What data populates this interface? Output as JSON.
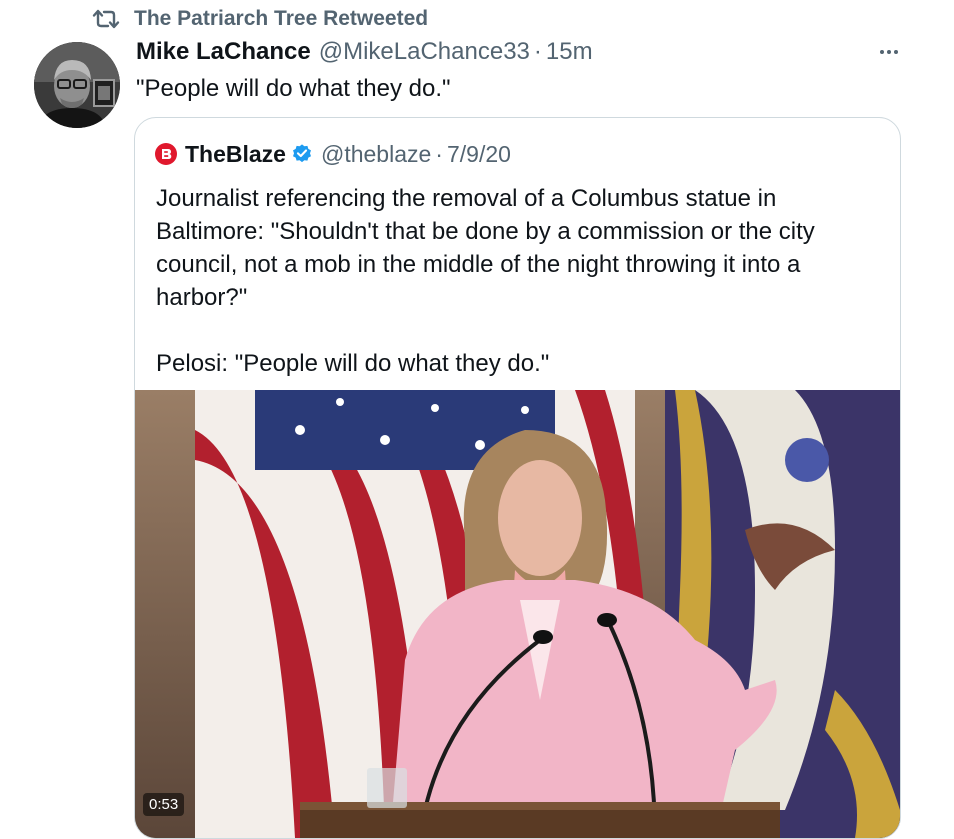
{
  "retweet": {
    "icon": "retweet-icon",
    "label": "The Patriarch Tree Retweeted"
  },
  "tweet": {
    "author_name": "Mike LaChance",
    "handle": "@MikeLaChance33",
    "separator": "·",
    "time": "15m",
    "text": "\"People will do what they do.\"",
    "more_icon": "more-horizontal-icon"
  },
  "quote": {
    "logo_icon": "theblaze-logo-icon",
    "author_name": "TheBlaze",
    "verified_icon": "verified-badge-icon",
    "handle": "@theblaze",
    "separator": "·",
    "date": "7/9/20",
    "paragraph_1": "Journalist referencing the removal of a Columbus statue in Baltimore: \"Shouldn't that be done by a commission or the city council, not a mob in the middle of the night throwing it into a harbor?\"",
    "paragraph_2": "Pelosi: \"People will do what they do.\"",
    "video": {
      "duration": "0:53"
    }
  },
  "colors": {
    "text_primary": "#0f1419",
    "text_secondary": "#536471",
    "border": "#cfd9de",
    "verified": "#1d9bf0",
    "blaze_red": "#e0182d"
  }
}
